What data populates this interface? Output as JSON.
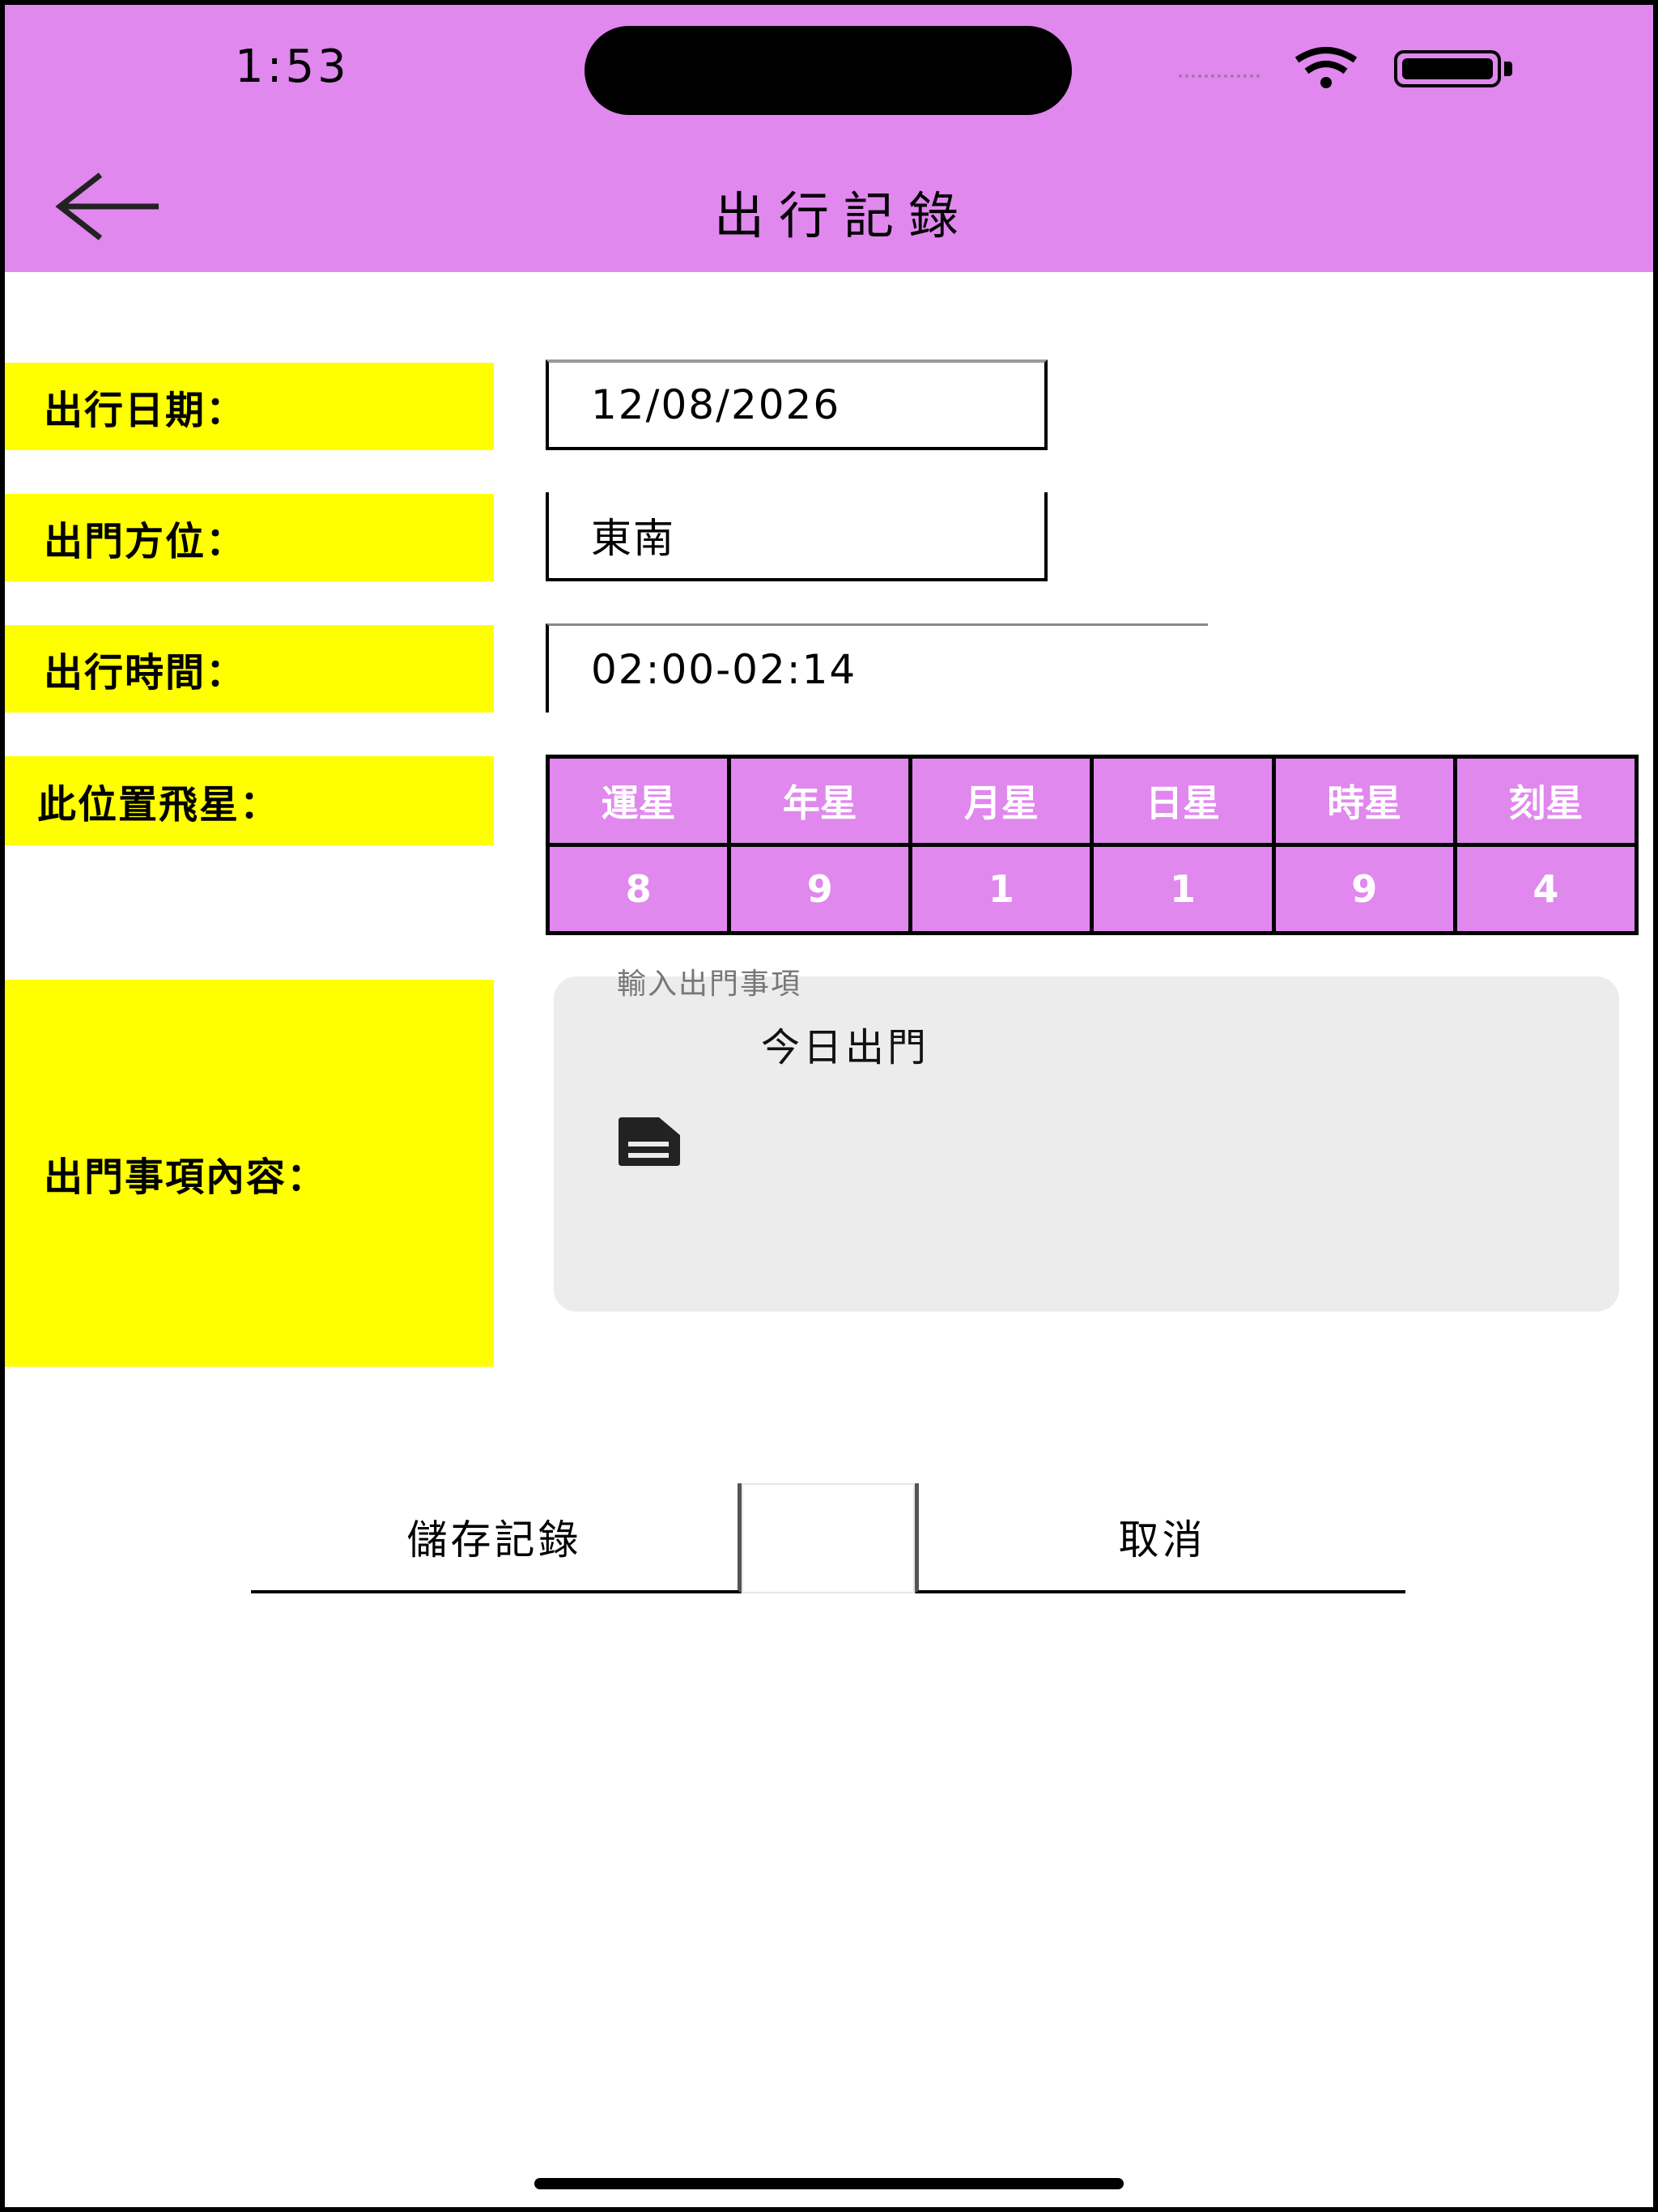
{
  "status_bar": {
    "time": "1:53"
  },
  "header": {
    "title": "出行記錄"
  },
  "form": {
    "date_label": "出行日期：",
    "date_value": "12/08/2026",
    "direction_label": "出門方位：",
    "direction_value": "東南",
    "time_label": "出行時間：",
    "time_value": "02:00-02:14",
    "stars_label": "此位置飛星：",
    "star_headers": [
      "運星",
      "年星",
      "月星",
      "日星",
      "時星",
      "刻星"
    ],
    "star_values": [
      "8",
      "9",
      "1",
      "1",
      "9",
      "4"
    ],
    "content_label": "出門事項內容：",
    "content_caption": "輸入出門事項",
    "content_value": "今日出門"
  },
  "buttons": {
    "save": "儲存記錄",
    "cancel": "取消"
  },
  "colors": {
    "header_bg": "#e088ee",
    "label_bg": "#ffff00",
    "star_bg": "#e088ee",
    "card_bg": "#ececec"
  },
  "icons": [
    "back-arrow-icon",
    "wifi-icon",
    "battery-icon",
    "document-icon"
  ]
}
